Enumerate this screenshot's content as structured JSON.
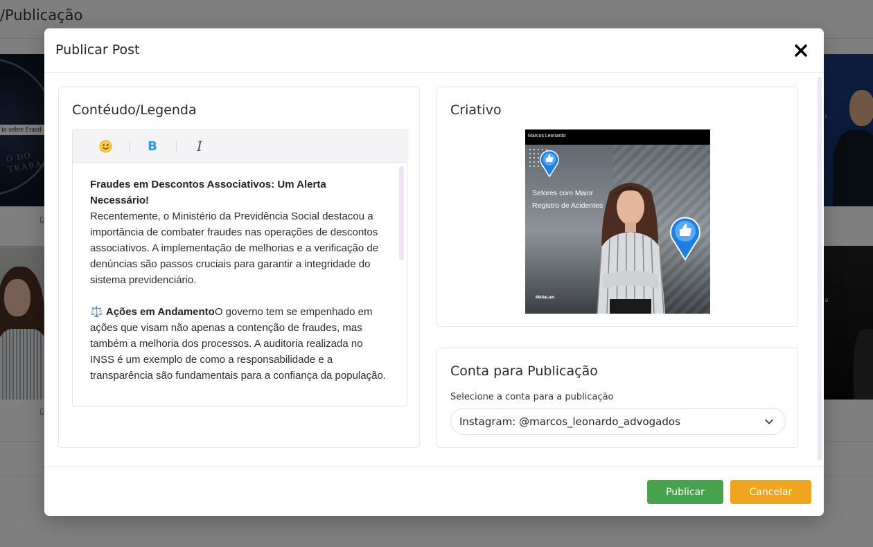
{
  "background": {
    "page_title": "/Publicação",
    "card_text_left": "io sobre Fraud",
    "seal_text": "O DO TRABA",
    "card_text_right_top": "s",
    "card_text_right_bottom": "a"
  },
  "modal": {
    "title": "Publicar Post",
    "content_card": {
      "title": "Contéudo/Legenda",
      "toolbar": {
        "emoji": "😊",
        "bold": "B",
        "italic": "I"
      },
      "text": {
        "heading": "Fraudes em Descontos Associativos: Um Alerta Necessário!",
        "paragraph1": "Recentemente, o Ministério da Previdência Social destacou a importância de combater fraudes nas operações de descontos associativos. A implementação de melhorias e a verificação de denúncias são passos cruciais para garantir a integridade do sistema previdenciário.",
        "section_icon": "⚖️",
        "section_heading": "Ações em Andamento",
        "paragraph2": "O governo tem se empenhado em ações que visam não apenas a contenção de fraudes, mas também a melhoria dos processos. A auditoria realizada no INSS é um exemplo de como a responsabilidade e a transparência são fundamentais para a confiança da população."
      }
    },
    "creative_card": {
      "title": "Criativo",
      "image": {
        "top_label": "Marcos Leonardo",
        "headline_line1": "Setores com Maior",
        "headline_line2": "Registro de Acidentes",
        "brand": "MidiaLaw"
      }
    },
    "account_card": {
      "title": "Conta para Publicação",
      "label": "Selecione a conta para a publicação",
      "selected": "Instagram: @marcos_leonardo_advogados"
    },
    "footer": {
      "publish_label": "Publicar",
      "cancel_label": "Cancelar"
    }
  },
  "colors": {
    "publish": "#46a24d",
    "cancel": "#f0a41f",
    "bold_icon": "#2d95ea",
    "pin": "#1e7fe0"
  },
  "icons": {
    "close": "close-icon",
    "emoji": "smile-emoji-icon",
    "bold": "bold-icon",
    "italic": "italic-icon",
    "chevron": "chevron-down-icon",
    "pin": "thumbs-up-pin-icon"
  }
}
